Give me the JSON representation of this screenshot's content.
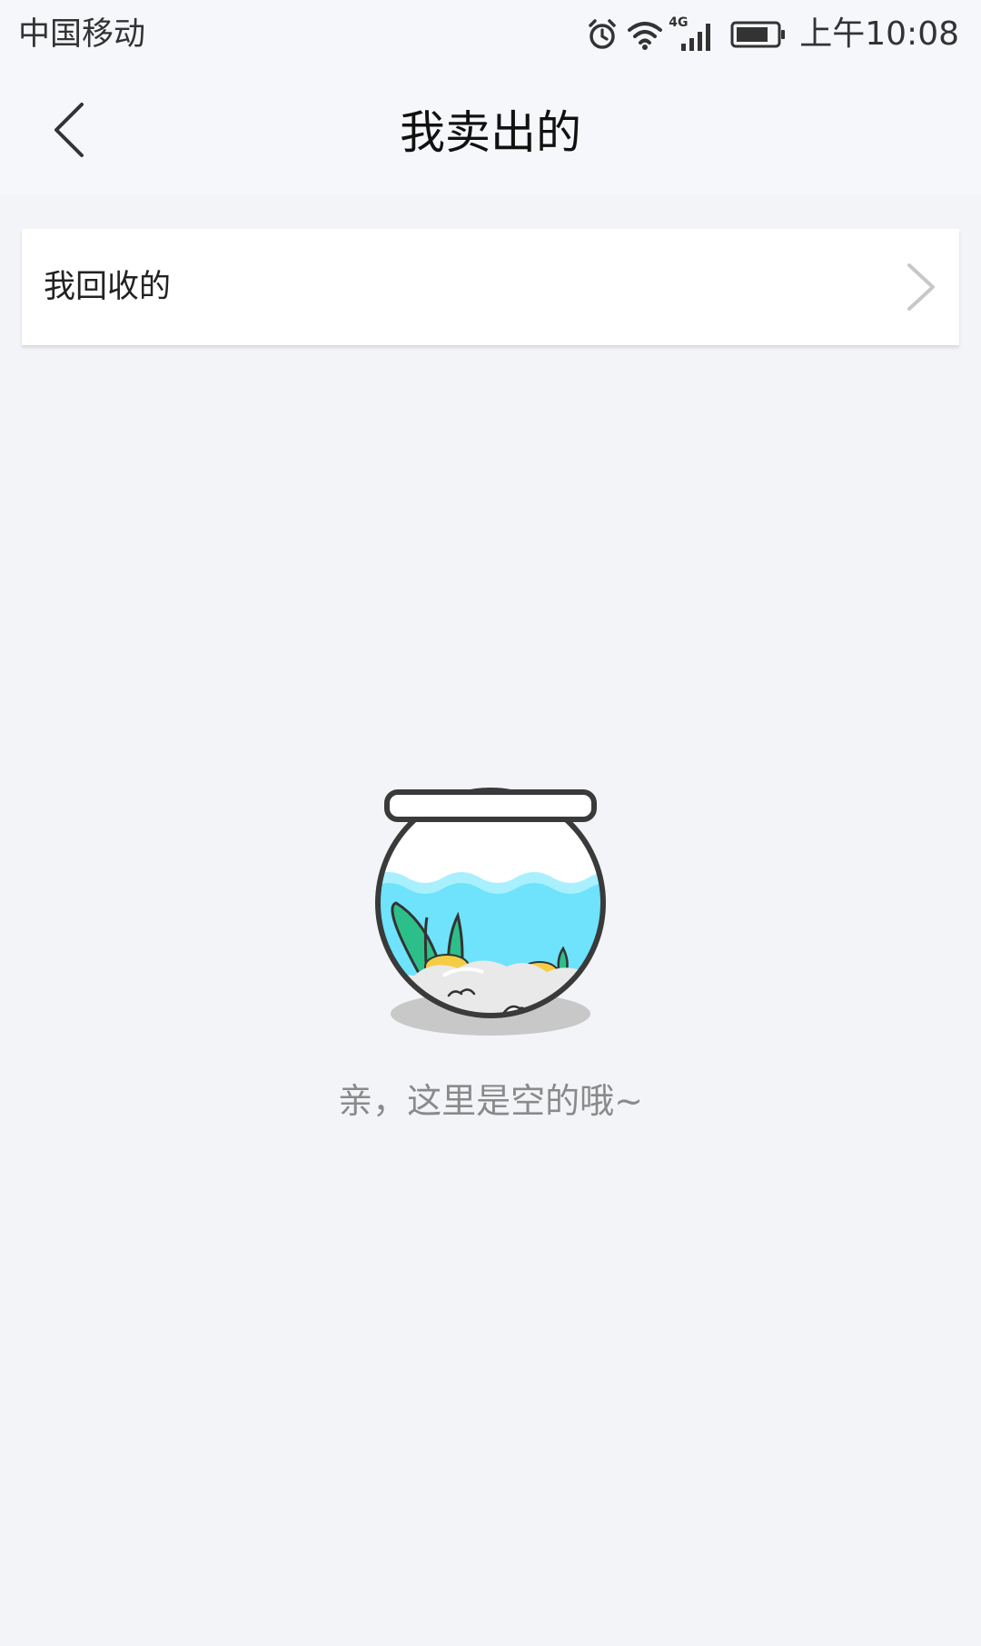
{
  "status_bar": {
    "carrier": "中国移动",
    "network": "4G",
    "time": "上午10:08",
    "icons": [
      "alarm-icon",
      "wifi-icon",
      "signal-icon",
      "battery-icon"
    ]
  },
  "header": {
    "back_icon": "chevron-left-icon",
    "title": "我卖出的"
  },
  "list": {
    "items": [
      {
        "label": "我回收的",
        "icon": "chevron-right-icon"
      }
    ]
  },
  "empty_state": {
    "illustration": "fishbowl-illustration",
    "message": "亲，这里是空的哦~"
  },
  "colors": {
    "background": "#f3f4f8",
    "header_bg": "#f6f7fb",
    "water": "#6ee3fb",
    "plant": "#2dbf8a",
    "text_muted": "#8a8a8a"
  }
}
